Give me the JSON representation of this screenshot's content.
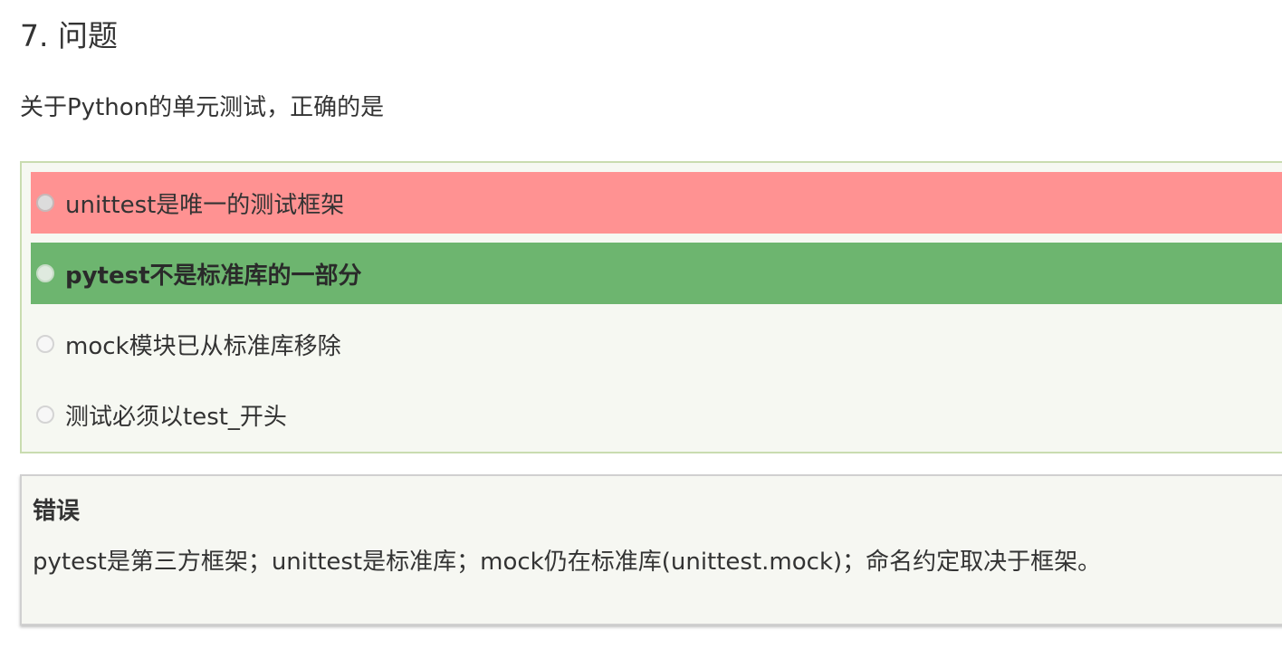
{
  "question": {
    "title": "7. 问题",
    "text": "关于Python的单元测试，正确的是"
  },
  "options": [
    {
      "label": "unittest是唯一的测试框架",
      "state": "wrong-selected"
    },
    {
      "label": "pytest不是标准库的一部分",
      "state": "correct"
    },
    {
      "label": "mock模块已从标准库移除",
      "state": "neutral"
    },
    {
      "label": "测试必须以test_开头",
      "state": "neutral"
    }
  ],
  "feedback": {
    "heading": "错误",
    "text": "pytest是第三方框架；unittest是标准库；mock仍在标准库(unittest.mock)；命名约定取决于框架。"
  },
  "colors": {
    "wrong": "#ff9292",
    "correct": "#6db56f",
    "options_background": "#f6f8f2",
    "options_border": "#c9dcb0"
  }
}
